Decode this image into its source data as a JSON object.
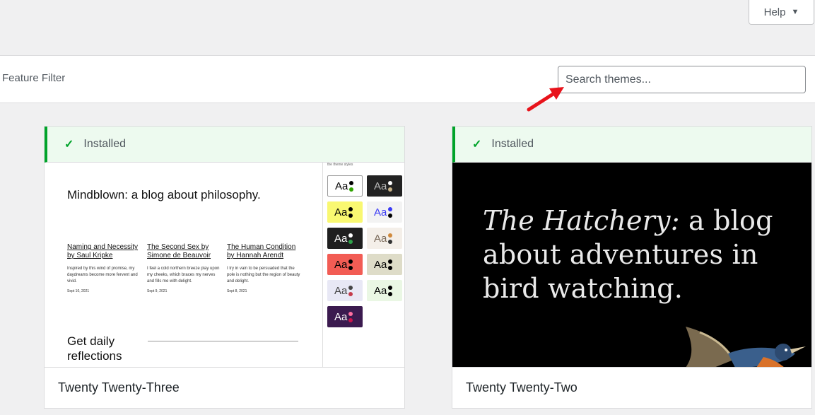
{
  "header": {
    "help_label": "Help"
  },
  "filter_bar": {
    "feature_filter_label": "Feature Filter",
    "search_placeholder": "Search themes..."
  },
  "themes": [
    {
      "name": "Twenty Twenty-Three",
      "status": "Installed",
      "preview": {
        "blog_title": "Mindblown: a blog about philosophy.",
        "styles_caption": "the theme styles",
        "posts": [
          {
            "title": "Naming and Necessity by Saul Kripke",
            "excerpt": "Inspired by this wind of promise, my daydreams become more fervent and vivid.",
            "date": "Sept 10, 2021"
          },
          {
            "title": "The Second Sex by Simone de Beauvoir",
            "excerpt": "I feel a cold northern breeze play upon my cheeks, which braces my nerves and fills me with delight.",
            "date": "Sept 9, 2021"
          },
          {
            "title": "The Human Condition by Hannah Arendt",
            "excerpt": "I try in vain to be persuaded that the pole is nothing but the region of beauty and delight.",
            "date": "Sept 8, 2021"
          }
        ],
        "daily_heading": "Get daily reflections",
        "style_variations": [
          {
            "label": "Aa",
            "bg": "#ffffff",
            "fg": "#000000",
            "dot1": "#000000",
            "dot2": "#2fa300"
          },
          {
            "label": "Aa",
            "bg": "#222222",
            "fg": "#bbbbbb",
            "dot1": "#ffffff",
            "dot2": "#c9b48a"
          },
          {
            "label": "Aa",
            "bg": "#f9f871",
            "fg": "#000000",
            "dot1": "#000000",
            "dot2": "#000000"
          },
          {
            "label": "Aa",
            "bg": "#f3f3f3",
            "fg": "#3b3bf5",
            "dot1": "#3b3bf5",
            "dot2": "#000000"
          },
          {
            "label": "Aa",
            "bg": "#1f1f1f",
            "fg": "#ffffff",
            "dot1": "#ffffff",
            "dot2": "#2fa34a"
          },
          {
            "label": "Aa",
            "bg": "#f4efe9",
            "fg": "#7a6a5a",
            "dot1": "#d08a3d",
            "dot2": "#333333"
          },
          {
            "label": "Aa",
            "bg": "#f25c54",
            "fg": "#000000",
            "dot1": "#000000",
            "dot2": "#000000"
          },
          {
            "label": "Aa",
            "bg": "#dedcc8",
            "fg": "#000000",
            "dot1": "#000000",
            "dot2": "#000000"
          },
          {
            "label": "Aa",
            "bg": "#e8e8f5",
            "fg": "#444444",
            "dot1": "#444444",
            "dot2": "#c43b4c"
          },
          {
            "label": "Aa",
            "bg": "#eaf7e4",
            "fg": "#000000",
            "dot1": "#000000",
            "dot2": "#000000"
          },
          {
            "label": "Aa",
            "bg": "#3b1a4f",
            "fg": "#ffffff",
            "dot1": "#ff6fa1",
            "dot2": "#c9144c"
          }
        ]
      }
    },
    {
      "name": "Twenty Twenty-Two",
      "status": "Installed",
      "preview": {
        "hero_italic": "The Hatchery:",
        "hero_rest_line1": " a blog",
        "hero_line2": "about adventures in",
        "hero_line3": "bird watching."
      }
    }
  ],
  "colors": {
    "installed_green": "#00a32a",
    "notice_bg": "#edfaef",
    "annotation_arrow": "#e8131b"
  },
  "icons": {
    "installed": "checkmark-icon",
    "help_caret": "caret-down-icon",
    "annotation": "red-arrow-icon"
  }
}
